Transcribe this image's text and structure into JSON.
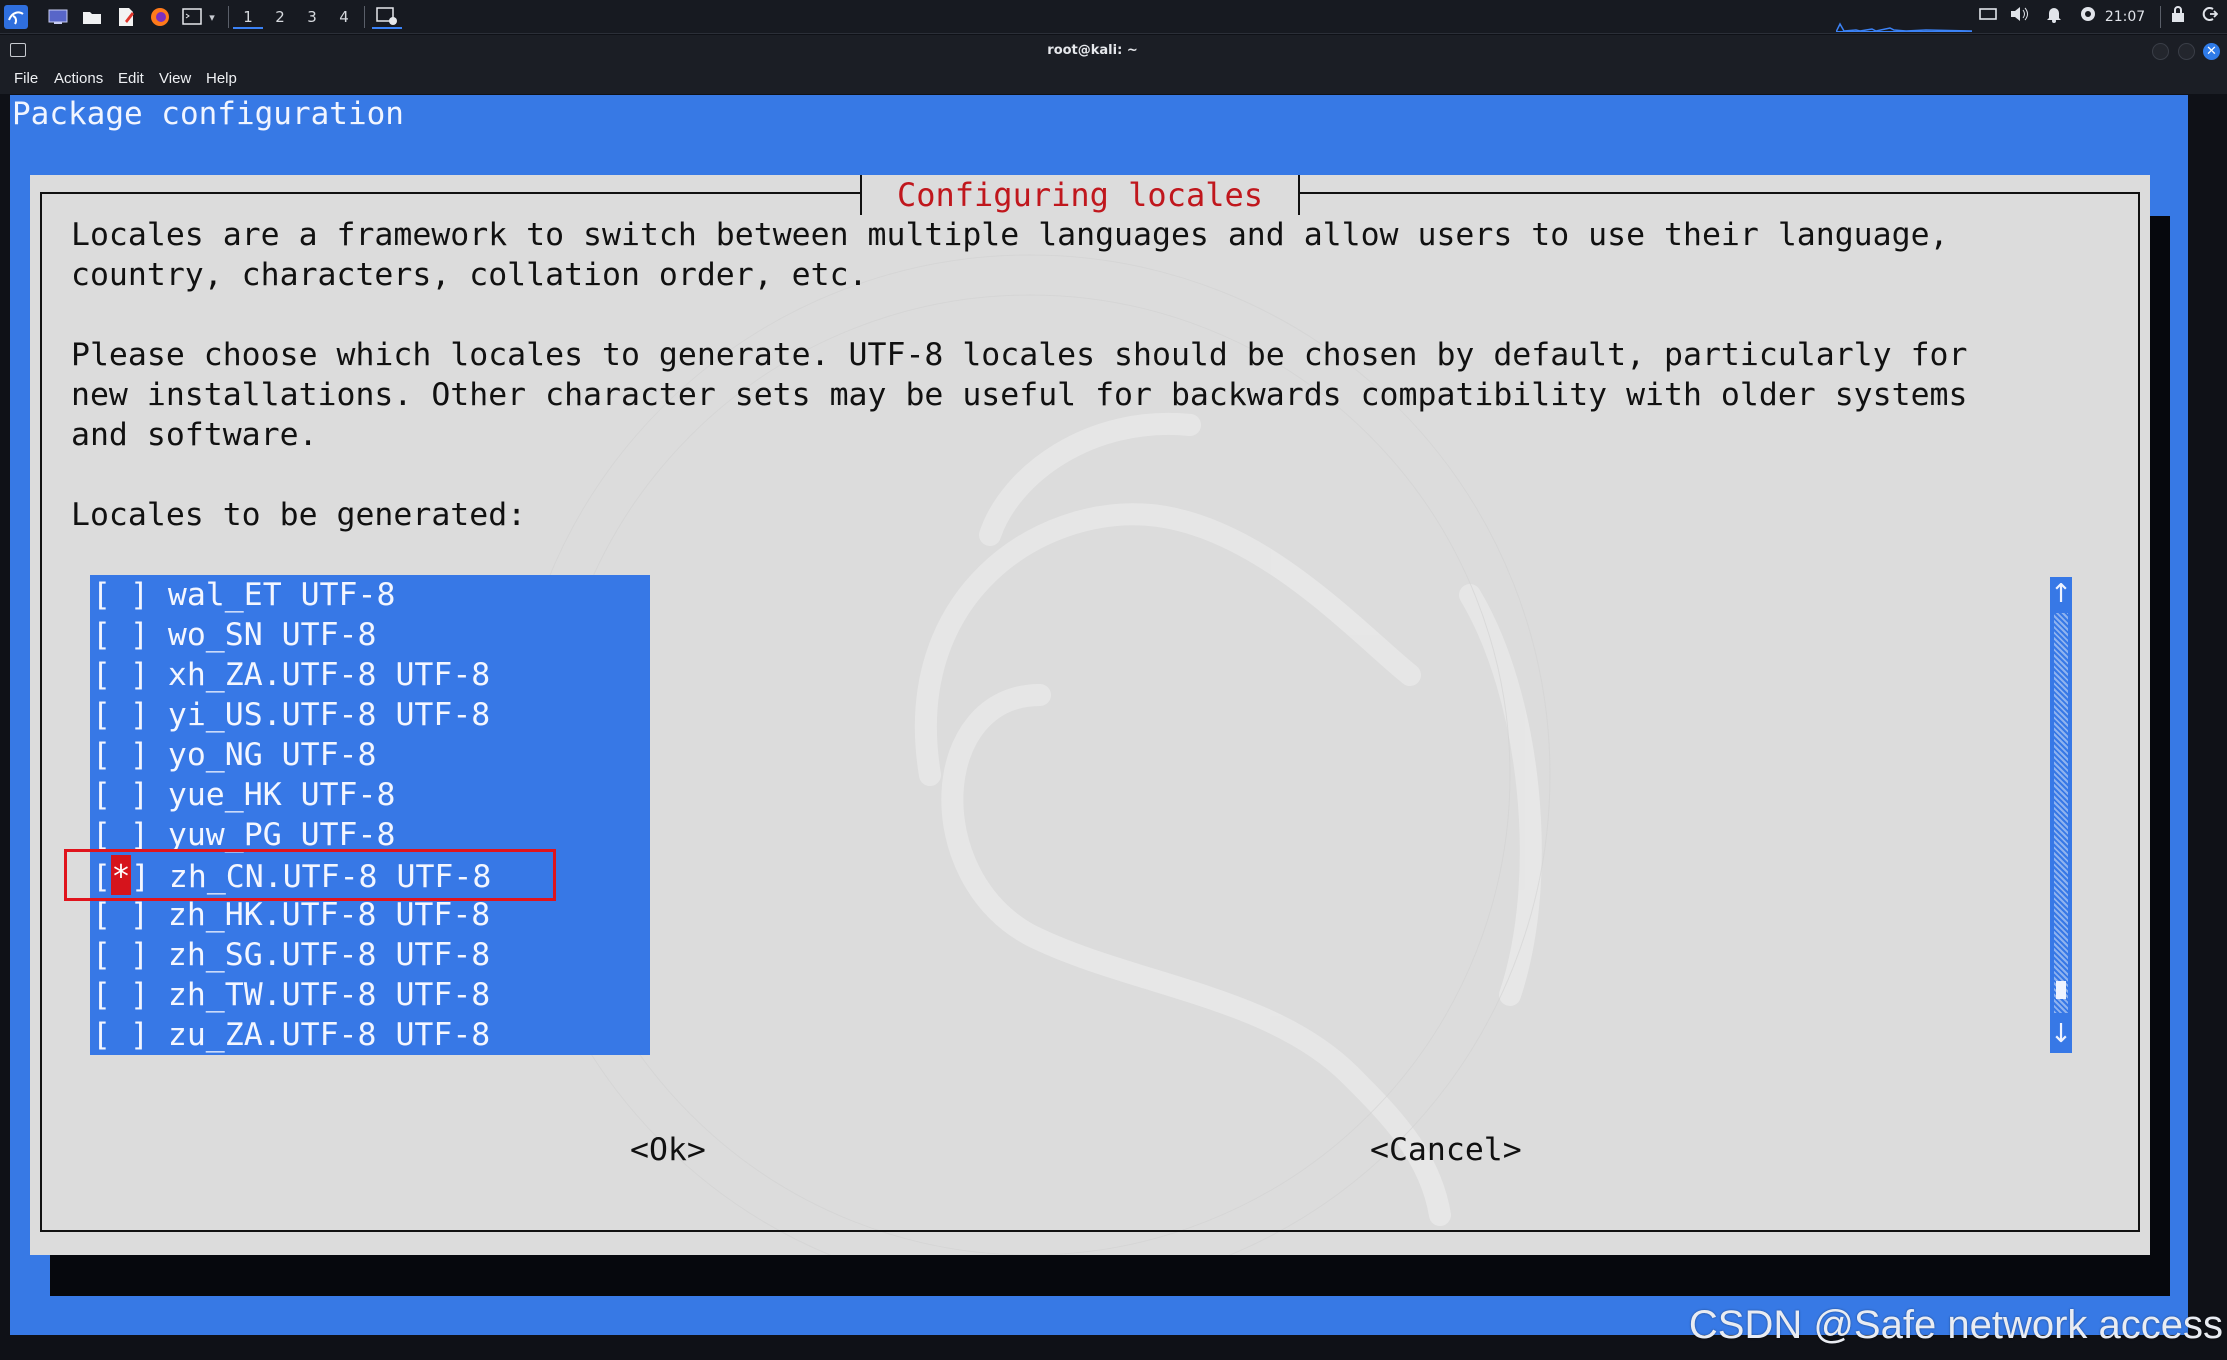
{
  "panel": {
    "workspaces": [
      "1",
      "2",
      "3",
      "4"
    ],
    "clock": "21:07",
    "icons": [
      "kali-menu-icon",
      "desktop-icon",
      "file-manager-icon",
      "text-editor-icon",
      "firefox-icon",
      "terminal-icon",
      "terminal-window-icon",
      "display-icon",
      "volume-icon",
      "notification-bell-icon",
      "update-icon",
      "lock-icon",
      "logout-icon"
    ],
    "colors": {
      "accent": "#3b82f6",
      "background": "#171a21"
    }
  },
  "window": {
    "title": "root@kali: ~",
    "menu": [
      "File",
      "Actions",
      "Edit",
      "View",
      "Help"
    ]
  },
  "terminal": {
    "backtitle": "Package configuration",
    "dialog": {
      "title": "Configuring locales",
      "paragraph1": [
        "Locales are a framework to switch between multiple languages and allow users to use their language,",
        "country, characters, collation order, etc."
      ],
      "paragraph2": [
        "Please choose which locales to generate. UTF-8 locales should be chosen by default, particularly for",
        "new installations. Other character sets may be useful for backwards compatibility with older systems",
        "and software."
      ],
      "list_label": "Locales to be generated:",
      "items": [
        {
          "checked": false,
          "label": "wal_ET UTF-8"
        },
        {
          "checked": false,
          "label": "wo_SN UTF-8"
        },
        {
          "checked": false,
          "label": "xh_ZA.UTF-8 UTF-8"
        },
        {
          "checked": false,
          "label": "yi_US.UTF-8 UTF-8"
        },
        {
          "checked": false,
          "label": "yo_NG UTF-8"
        },
        {
          "checked": false,
          "label": "yue_HK UTF-8"
        },
        {
          "checked": false,
          "label": "yuw_PG UTF-8"
        },
        {
          "checked": true,
          "label": "zh_CN.UTF-8 UTF-8"
        },
        {
          "checked": false,
          "label": "zh_HK.UTF-8 UTF-8"
        },
        {
          "checked": false,
          "label": "zh_SG.UTF-8 UTF-8"
        },
        {
          "checked": false,
          "label": "zh_TW.UTF-8 UTF-8"
        },
        {
          "checked": false,
          "label": "zu_ZA.UTF-8 UTF-8"
        }
      ],
      "ok_label": "<Ok>",
      "cancel_label": "<Cancel>",
      "scroll_up": "↑",
      "scroll_down": "↓",
      "colors": {
        "dialog_bg": "#dcdcdc",
        "list_bg": "#3778e6",
        "title": "#c0171d",
        "selection": "#d6141c"
      }
    }
  },
  "watermark": "CSDN @Safe network access"
}
